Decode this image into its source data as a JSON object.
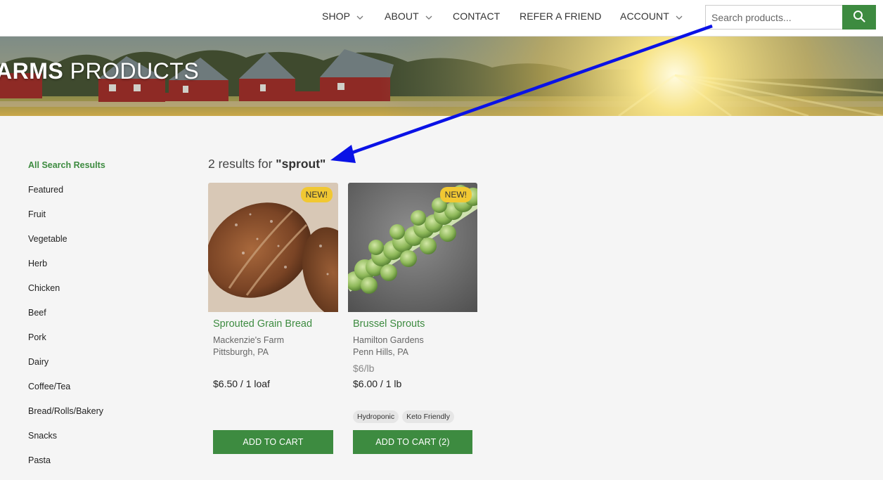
{
  "nav": {
    "items": [
      {
        "label": "SHOP",
        "has_dropdown": true
      },
      {
        "label": "ABOUT",
        "has_dropdown": true
      },
      {
        "label": "CONTACT",
        "has_dropdown": false
      },
      {
        "label": "REFER A FRIEND",
        "has_dropdown": false
      },
      {
        "label": "ACCOUNT",
        "has_dropdown": true
      }
    ],
    "search": {
      "placeholder": "Search products...",
      "value": "",
      "icon": "search-icon"
    }
  },
  "hero": {
    "title_bold": "ARMS",
    "title_thin": " PRODUCTS"
  },
  "sidebar": {
    "categories": [
      {
        "label": "All Search Results",
        "active": true
      },
      {
        "label": "Featured"
      },
      {
        "label": "Fruit"
      },
      {
        "label": "Vegetable"
      },
      {
        "label": "Herb"
      },
      {
        "label": "Chicken"
      },
      {
        "label": "Beef"
      },
      {
        "label": "Pork"
      },
      {
        "label": "Dairy"
      },
      {
        "label": "Coffee/Tea"
      },
      {
        "label": "Bread/Rolls/Bakery"
      },
      {
        "label": "Snacks"
      },
      {
        "label": "Pasta"
      }
    ]
  },
  "results": {
    "count_text": "2 results for ",
    "query": "\"sprout\""
  },
  "products": [
    {
      "badge": "NEW!",
      "name": "Sprouted Grain Bread",
      "farm": "Mackenzie's Farm",
      "location": "Pittsburgh, PA",
      "unit_price": "",
      "price": "$6.50 / 1 loaf",
      "tags": [],
      "button": "ADD TO CART"
    },
    {
      "badge": "NEW!",
      "name": "Brussel Sprouts",
      "farm": "Hamilton Gardens",
      "location": "Penn Hills, PA",
      "unit_price": "$6/lb",
      "price": "$6.00 / 1 lb",
      "tags": [
        "Hydroponic",
        "Keto Friendly"
      ],
      "button": "ADD TO CART (2)"
    }
  ],
  "colors": {
    "brand_green": "#3d8b40",
    "badge_yellow": "#f1c832",
    "annotation_arrow": "#0a12e6"
  }
}
